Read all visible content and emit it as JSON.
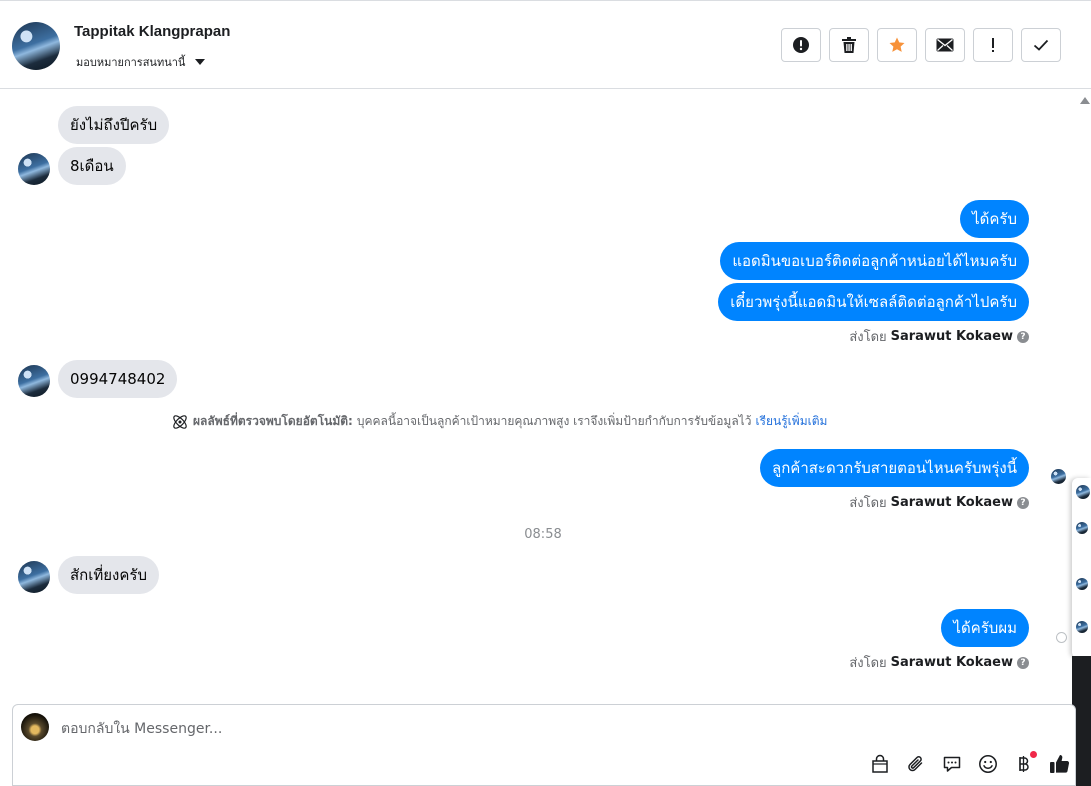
{
  "header": {
    "contact_name": "Tappitak Klangprapan",
    "assign_label": "มอบหมายการสนทนานี้",
    "actions": [
      {
        "name": "spam-button",
        "icon": "alert-circle-icon"
      },
      {
        "name": "delete-button",
        "icon": "trash-icon"
      },
      {
        "name": "star-button",
        "icon": "star-icon",
        "color": "#f7923a"
      },
      {
        "name": "mark-unread-button",
        "icon": "envelope-icon"
      },
      {
        "name": "follow-up-button",
        "icon": "exclamation-icon"
      },
      {
        "name": "mark-done-button",
        "icon": "checkmark-icon"
      }
    ]
  },
  "messages": {
    "m1": "ยังไม่ถึงปีครับ",
    "m2": "8เดือน",
    "m3": "ได้ครับ",
    "m4": "แอดมินขอเบอร์ติดต่อลูกค้าหน่อยได้ไหมครับ",
    "m5": "เดี๋ยวพรุ่งนี้แอดมินให้เซลล์ติดต่อลูกค้าไปครับ",
    "m6": "0994748402",
    "m7": "ลูกค้าสะดวกรับสายตอนไหนครับพรุ่งนี้",
    "m8": "สักเที่ยงครับ",
    "m9": "ได้ครับผม"
  },
  "sent_by": {
    "prefix": "ส่งโดย",
    "agent": "Sarawut Kokaew"
  },
  "notice": {
    "label": "ผลลัพธ์ที่ตรวจพบโดยอัตโนมัติ:",
    "text": "บุคคลนี้อาจเป็นลูกค้าเป้าหมายคุณภาพสูง เราจึงเพิ่มป้ายกำกับการรับข้อมูลไว้",
    "link": "เรียนรู้เพิ่มเติม"
  },
  "timestamp": "08:58",
  "composer": {
    "placeholder": "ตอบกลับใน Messenger...",
    "tools": [
      "shop-icon",
      "attachment-icon",
      "saved-reply-icon",
      "emoji-icon",
      "baht-payment-icon",
      "like-icon"
    ]
  },
  "colors": {
    "outgoing": "#0084ff",
    "incoming": "#e4e6eb",
    "link": "#216fdb",
    "star": "#f7923a"
  }
}
